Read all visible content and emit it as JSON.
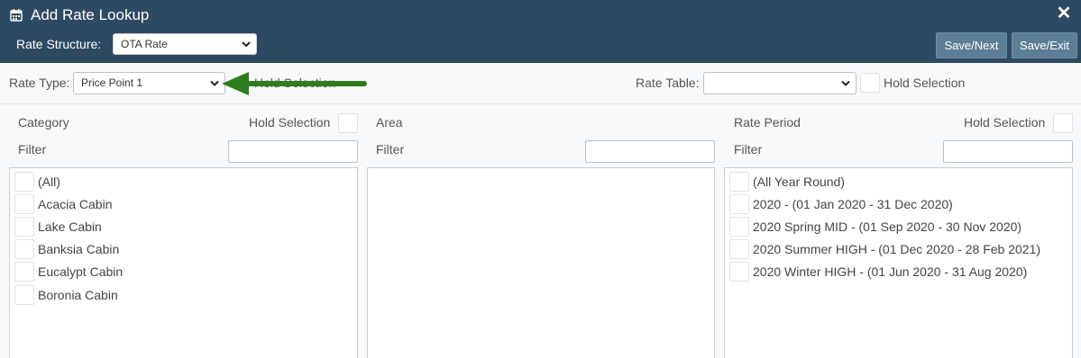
{
  "dialog": {
    "title": "Add Rate Lookup",
    "title_icon": "calendar-icon",
    "close_icon": "close-icon"
  },
  "header": {
    "rate_structure_label": "Rate Structure:",
    "rate_structure_value": "OTA Rate"
  },
  "buttons": {
    "save_next": "Save/Next",
    "save_exit": "Save/Exit"
  },
  "rate_type": {
    "label": "Rate Type:",
    "value": "Price Point 1",
    "hold_selection_label_partial": "Hold Selection"
  },
  "rate_table": {
    "label": "Rate Table:",
    "value": "",
    "hold_selection_label": "Hold Selection"
  },
  "category": {
    "header": "Category",
    "hold_selection_label": "Hold Selection",
    "filter_label": "Filter",
    "items": [
      "(All)",
      "Acacia Cabin",
      "Lake Cabin",
      "Banksia Cabin",
      "Eucalypt Cabin",
      "Boronia Cabin"
    ]
  },
  "area": {
    "header": "Area",
    "filter_label": "Filter",
    "items": []
  },
  "rate_period": {
    "header": "Rate Period",
    "hold_selection_label": "Hold Selection",
    "filter_label": "Filter",
    "items": [
      "(All Year Round)",
      "2020 - (01 Jan 2020 - 31 Dec 2020)",
      "2020 Spring MID - (01 Sep 2020 - 30 Nov 2020)",
      "2020 Summer HIGH - (01 Dec 2020 - 28 Feb 2021)",
      "2020 Winter HIGH - (01 Jun 2020 - 31 Aug 2020)"
    ]
  },
  "colors": {
    "header_bg": "#2e4a63",
    "button_bg": "#5d7f95",
    "arrow": "#2e7d1e"
  }
}
